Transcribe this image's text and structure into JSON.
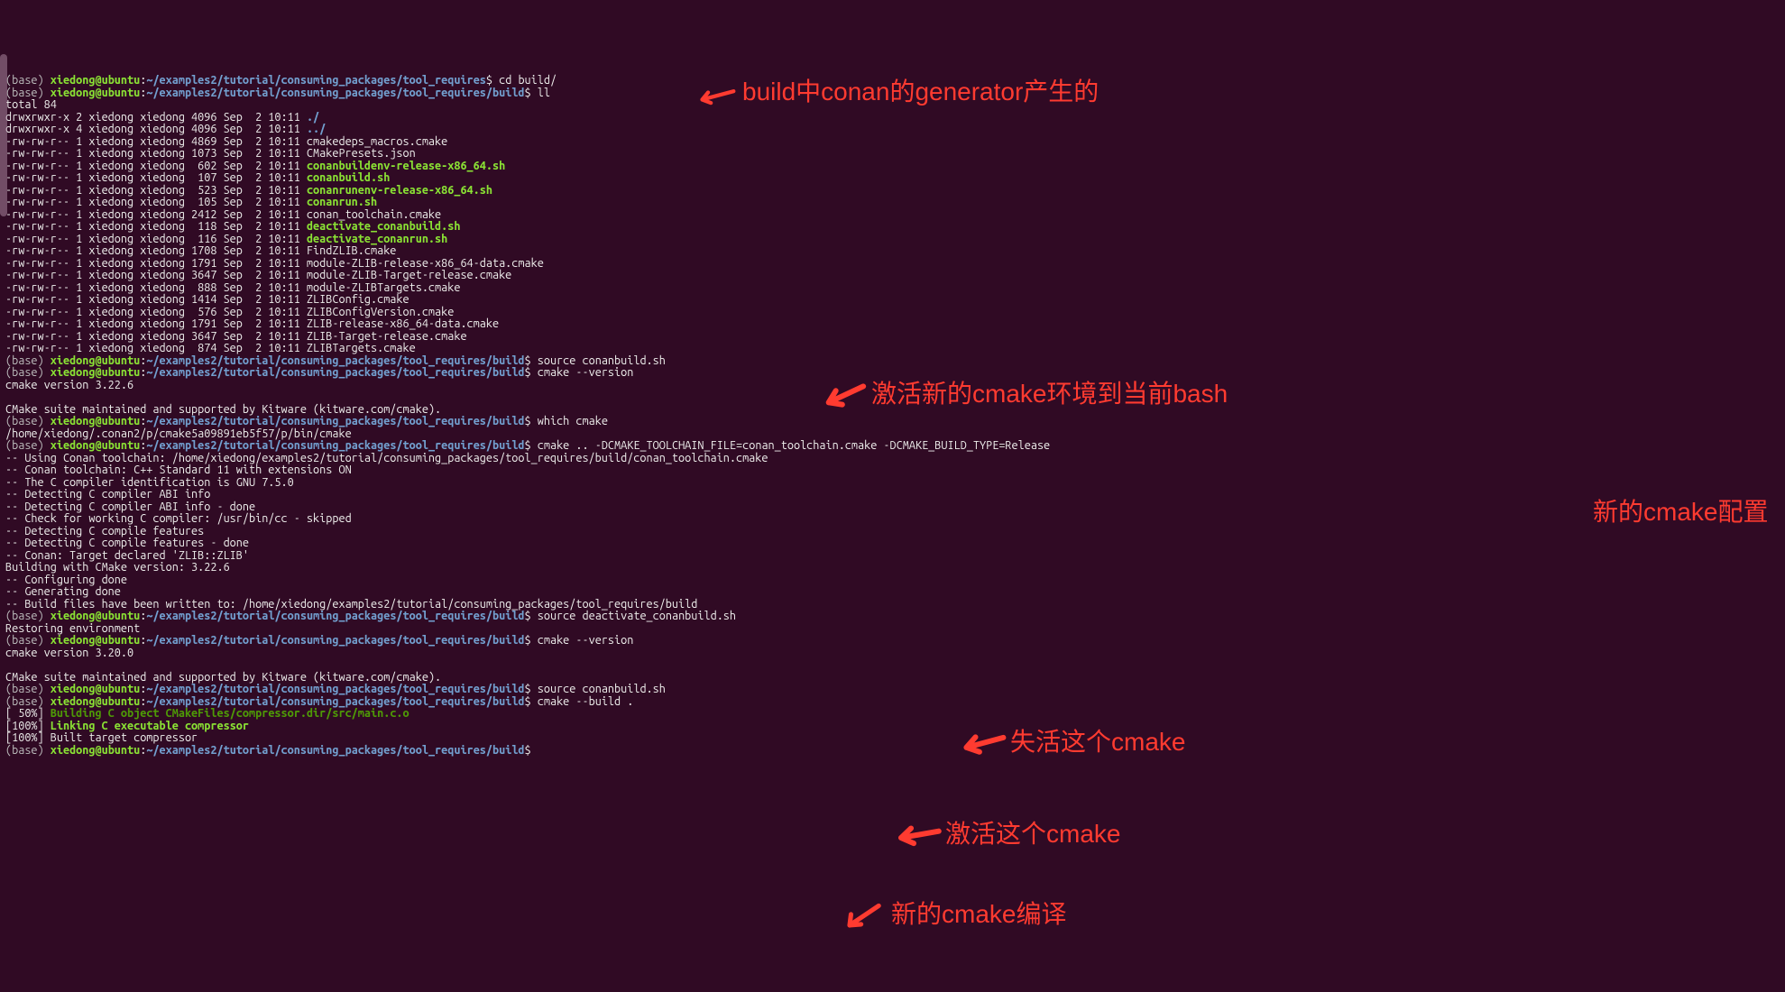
{
  "prompt": {
    "env": "(base) ",
    "user": "xiedong@ubuntu",
    "colon": ":",
    "path_short": "~/examples2/tutorial/consuming_packages/tool_requires",
    "path_build": "~/examples2/tutorial/consuming_packages/tool_requires/build",
    "dollar": "$ "
  },
  "cmds": {
    "cd_build": "cd build/",
    "ll": "ll",
    "source_build": "source conanbuild.sh",
    "cmake_version": "cmake --version",
    "which_cmake": "which cmake",
    "cmake_cfg": "cmake .. -DCMAKE_TOOLCHAIN_FILE=conan_toolchain.cmake -DCMAKE_BUILD_TYPE=Release",
    "source_deact": "source deactivate_conanbuild.sh",
    "cmake_build": "cmake --build ."
  },
  "ll": {
    "total": "total 84",
    "e0": "drwxrwxr-x 2 xiedong xiedong 4096 Sep  2 10:11 ",
    "f0": "./",
    "e1": "drwxrwxr-x 4 xiedong xiedong 4096 Sep  2 10:11 ",
    "f1": "../",
    "e2": "-rw-rw-r-- 1 xiedong xiedong 4869 Sep  2 10:11 cmakedeps_macros.cmake",
    "e3": "-rw-rw-r-- 1 xiedong xiedong 1073 Sep  2 10:11 CMakePresets.json",
    "e4": "-rw-rw-r-- 1 xiedong xiedong  602 Sep  2 10:11 ",
    "f4": "conanbuildenv-release-x86_64.sh",
    "e5": "-rw-rw-r-- 1 xiedong xiedong  107 Sep  2 10:11 ",
    "f5": "conanbuild.sh",
    "e6": "-rw-rw-r-- 1 xiedong xiedong  523 Sep  2 10:11 ",
    "f6": "conanrunenv-release-x86_64.sh",
    "e7": "-rw-rw-r-- 1 xiedong xiedong  105 Sep  2 10:11 ",
    "f7": "conanrun.sh",
    "e8": "-rw-rw-r-- 1 xiedong xiedong 2412 Sep  2 10:11 conan_toolchain.cmake",
    "e9": "-rw-rw-r-- 1 xiedong xiedong  118 Sep  2 10:11 ",
    "f9": "deactivate_conanbuild.sh",
    "e10": "-rw-rw-r-- 1 xiedong xiedong  116 Sep  2 10:11 ",
    "f10": "deactivate_conanrun.sh",
    "e11": "-rw-rw-r-- 1 xiedong xiedong 1708 Sep  2 10:11 FindZLIB.cmake",
    "e12": "-rw-rw-r-- 1 xiedong xiedong 1791 Sep  2 10:11 module-ZLIB-release-x86_64-data.cmake",
    "e13": "-rw-rw-r-- 1 xiedong xiedong 3647 Sep  2 10:11 module-ZLIB-Target-release.cmake",
    "e14": "-rw-rw-r-- 1 xiedong xiedong  888 Sep  2 10:11 module-ZLIBTargets.cmake",
    "e15": "-rw-rw-r-- 1 xiedong xiedong 1414 Sep  2 10:11 ZLIBConfig.cmake",
    "e16": "-rw-rw-r-- 1 xiedong xiedong  576 Sep  2 10:11 ZLIBConfigVersion.cmake",
    "e17": "-rw-rw-r-- 1 xiedong xiedong 1791 Sep  2 10:11 ZLIB-release-x86_64-data.cmake",
    "e18": "-rw-rw-r-- 1 xiedong xiedong 3647 Sep  2 10:11 ZLIB-Target-release.cmake",
    "e19": "-rw-rw-r-- 1 xiedong xiedong  874 Sep  2 10:11 ZLIBTargets.cmake"
  },
  "out": {
    "v1": "cmake version 3.22.6",
    "blank": "",
    "suite": "CMake suite maintained and supported by Kitware (kitware.com/cmake).",
    "which": "/home/xiedong/.conan2/p/cmake5a09891eb5f57/p/bin/cmake",
    "cfg0": "-- Using Conan toolchain: /home/xiedong/examples2/tutorial/consuming_packages/tool_requires/build/conan_toolchain.cmake",
    "cfg1": "-- Conan toolchain: C++ Standard 11 with extensions ON",
    "cfg2": "-- The C compiler identification is GNU 7.5.0",
    "cfg3": "-- Detecting C compiler ABI info",
    "cfg4": "-- Detecting C compiler ABI info - done",
    "cfg5": "-- Check for working C compiler: /usr/bin/cc - skipped",
    "cfg6": "-- Detecting C compile features",
    "cfg7": "-- Detecting C compile features - done",
    "cfg8": "-- Conan: Target declared 'ZLIB::ZLIB'",
    "cfg9": "Building with CMake version: 3.22.6",
    "cfg10": "-- Configuring done",
    "cfg11": "-- Generating done",
    "cfg12": "-- Build files have been written to: /home/xiedong/examples2/tutorial/consuming_packages/tool_requires/build",
    "restore": "Restoring environment",
    "v2": "cmake version 3.20.0",
    "b_50a": "[ 50%] ",
    "b_50b": "Building C object CMakeFiles/compressor.dir/src/main.c.o",
    "b_100a": "[100%] ",
    "b_100b": "Linking C executable compressor",
    "b_100c": "[100%] Built target compressor"
  },
  "annotations": {
    "a1": "build中conan的generator产生的",
    "a2": "激活新的cmake环境到当前bash",
    "a3": "新的cmake配置",
    "a4": "失活这个cmake",
    "a5": "激活这个cmake",
    "a6": "新的cmake编译"
  }
}
